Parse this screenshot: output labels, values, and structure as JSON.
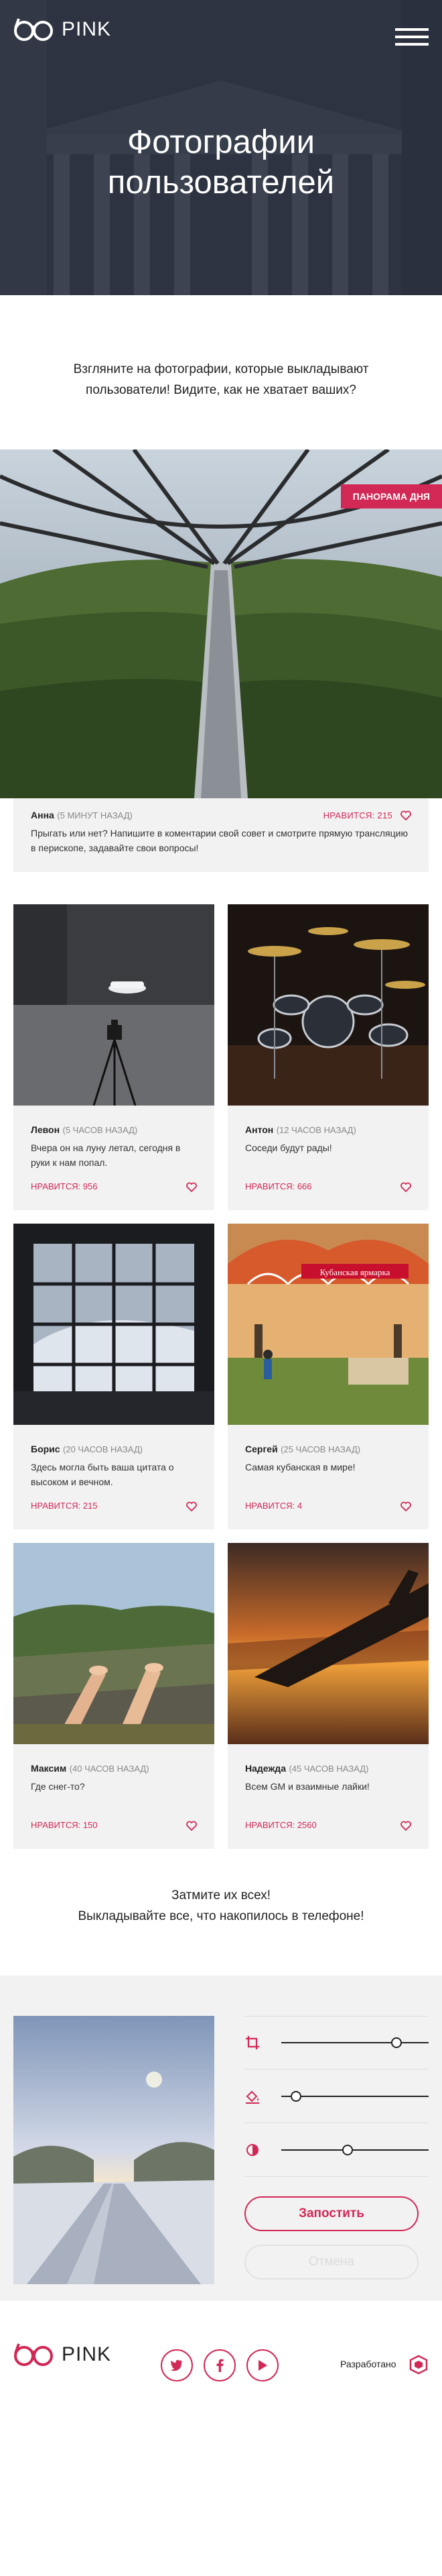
{
  "header": {
    "logo_text": "PINK",
    "title_line1": "Фотографии",
    "title_line2": "пользователей"
  },
  "intro": {
    "text": "Взгляните на фотографии, которые выкладывают пользователи! Видите, как не хватает ваших?"
  },
  "featured": {
    "badge": "ПАНОРАМА ДНЯ",
    "author": "Анна",
    "ago": "5 МИНУТ НАЗАД",
    "comment": "Прыгать или нет? Напишите в коментарии свой совет и смотрите прямую трансляцию в перископе, задавайте свои вопросы!",
    "likes": "НРАВИТСЯ: 215"
  },
  "photos": [
    {
      "author": "Левон",
      "ago": "5 ЧАСОВ НАЗАД",
      "comment": "Вчера он на луну летал, сегодня в руки к нам попал.",
      "likes": "НРАВИТСЯ: 956"
    },
    {
      "author": "Антон",
      "ago": "12 ЧАСОВ НАЗАД",
      "comment": "Соседи будут рады!",
      "likes": "НРАВИТСЯ: 666"
    },
    {
      "author": "Борис",
      "ago": "20 ЧАСОВ НАЗАД",
      "comment": "Здесь могла быть ваша цитата о высоком и вечном.",
      "likes": "НРАВИТСЯ: 215"
    },
    {
      "author": "Сергей",
      "ago": "25 ЧАСОВ НАЗАД",
      "comment": "Самая кубанская в мире!",
      "likes": "НРАВИТСЯ: 4"
    },
    {
      "author": "Максим",
      "ago": "40 ЧАСОВ НАЗАД",
      "comment": "Где снег-то?",
      "likes": "НРАВИТСЯ: 150"
    },
    {
      "author": "Надежда",
      "ago": "45 ЧАСОВ НАЗАД",
      "comment": "Всем GM и взаимные лайки!",
      "likes": "НРАВИТСЯ: 2560"
    }
  ],
  "photo_signs": {
    "market_sign": "Кубанская ярмарка"
  },
  "cta": {
    "line1": "Затмите их всех!",
    "line2": "Выкладывайте все, что накопилось в телефоне!"
  },
  "editor": {
    "sliders": [
      {
        "icon": "crop-icon",
        "value": 0.78
      },
      {
        "icon": "fill-icon",
        "value": 0.1
      },
      {
        "icon": "contrast-icon",
        "value": 0.45
      }
    ],
    "submit_label": "Запостить",
    "reset_label": "Отмена"
  },
  "footer": {
    "logo_text": "PINK",
    "socials": [
      "twitter-icon",
      "facebook-icon",
      "youtube-icon"
    ],
    "developed_by": "Разработано"
  },
  "colors": {
    "accent": "#d22856",
    "panel": "#f2f2f2",
    "hero_overlay": "#1e2430"
  }
}
